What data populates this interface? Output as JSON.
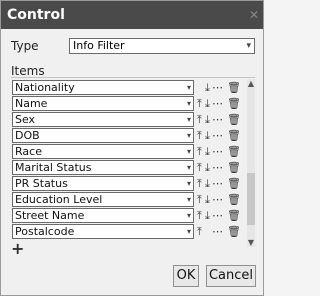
{
  "window": {
    "title": "Control"
  },
  "type_field": {
    "label": "Type",
    "value": "Info Filter"
  },
  "items_section": {
    "label": "Items"
  },
  "items": [
    "Nationality",
    "Name",
    "Sex",
    "DOB",
    "Race",
    "Marital Status",
    "PR Status",
    "Education Level",
    "Street Name",
    "Postalcode"
  ],
  "buttons": {
    "ok": "OK",
    "cancel": "Cancel"
  },
  "icons": {
    "dropdown": "chevron-down-icon",
    "move_up": "arrow-up-icon",
    "move_down": "arrow-down-icon",
    "more": "more-icon",
    "delete": "trash-icon",
    "add": "plus-icon"
  }
}
